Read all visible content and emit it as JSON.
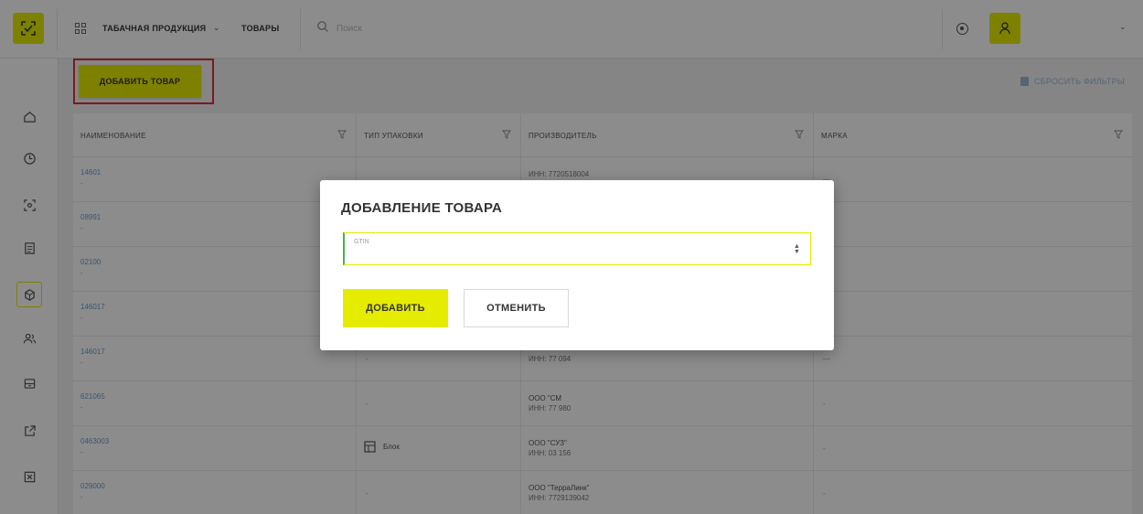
{
  "colors": {
    "accent": "#e6ec00",
    "highlight_border": "#e0303a",
    "link": "#6b9bd1",
    "overlay": "rgba(0,0,0,0.45)"
  },
  "header": {
    "logo_icon": "scan-code-icon",
    "apps_icon": "apps-grid-icon",
    "breadcrumb_category": "ТАБАЧНАЯ ПРОДУКЦИЯ",
    "breadcrumb_section": "ТОВАРЫ",
    "search_placeholder": "Поиск",
    "notification_icon": "notification-icon",
    "user_icon": "user-icon"
  },
  "sidebar": {
    "items": [
      {
        "icon": "home-icon"
      },
      {
        "icon": "clock-icon"
      },
      {
        "icon": "scan-icon"
      },
      {
        "icon": "document-icon"
      },
      {
        "icon": "cube-icon",
        "active": true
      },
      {
        "icon": "users-icon"
      },
      {
        "icon": "archive-icon"
      },
      {
        "icon": "export-icon"
      },
      {
        "icon": "close-box-icon"
      }
    ]
  },
  "toolbar": {
    "add_product_label": "ДОБАВИТЬ ТОВАР",
    "reset_filters_label": "СБРОСИТЬ ФИЛЬТРЫ"
  },
  "table": {
    "columns": [
      {
        "label": "НАИМЕНОВАНИЕ"
      },
      {
        "label": "ТИП УПАКОВКИ"
      },
      {
        "label": "ПРОИЗВОДИТЕЛЬ"
      },
      {
        "label": "МАРКА"
      }
    ],
    "rows": [
      {
        "name": "14601",
        "sub": "-",
        "pack": "",
        "man_1": "",
        "man_2": "ИНН: 7720518004",
        "brand": "—"
      },
      {
        "name": "08991",
        "sub": "-",
        "pack": "",
        "man_1": "",
        "man_2": "",
        "brand": "—"
      },
      {
        "name": "02100",
        "sub": "-",
        "pack": "",
        "man_1": "",
        "man_2": "",
        "brand": "—"
      },
      {
        "name": "146017",
        "sub": "-",
        "pack": "",
        "man_1": "",
        "man_2": "",
        "brand": "—"
      },
      {
        "name": "146017",
        "sub": "-",
        "pack": "-",
        "man_1": "",
        "man_2": "ИНН: 77     094",
        "brand": "—"
      },
      {
        "name": "621065",
        "sub": "-",
        "pack": "-",
        "man_1": "ООО \"СМ",
        "man_2": "ИНН: 77     980",
        "brand": "-"
      },
      {
        "name": "0463003",
        "sub": "-",
        "pack": "Блок",
        "man_1": "ООО \"СУЗ\"",
        "man_2": "ИНН: 03     156",
        "brand": "-"
      },
      {
        "name": "029000",
        "sub": "-",
        "pack": "-",
        "man_1": "ООО \"ТерраЛинк\"",
        "man_2": "ИНН: 7729139042",
        "brand": "-"
      }
    ]
  },
  "modal": {
    "title": "ДОБАВЛЕНИЕ ТОВАРА",
    "field_label": "GTIN",
    "field_value": "",
    "stepper_icon": "stepper-icon",
    "add_label": "ДОБАВИТЬ",
    "cancel_label": "ОТМЕНИТЬ"
  }
}
